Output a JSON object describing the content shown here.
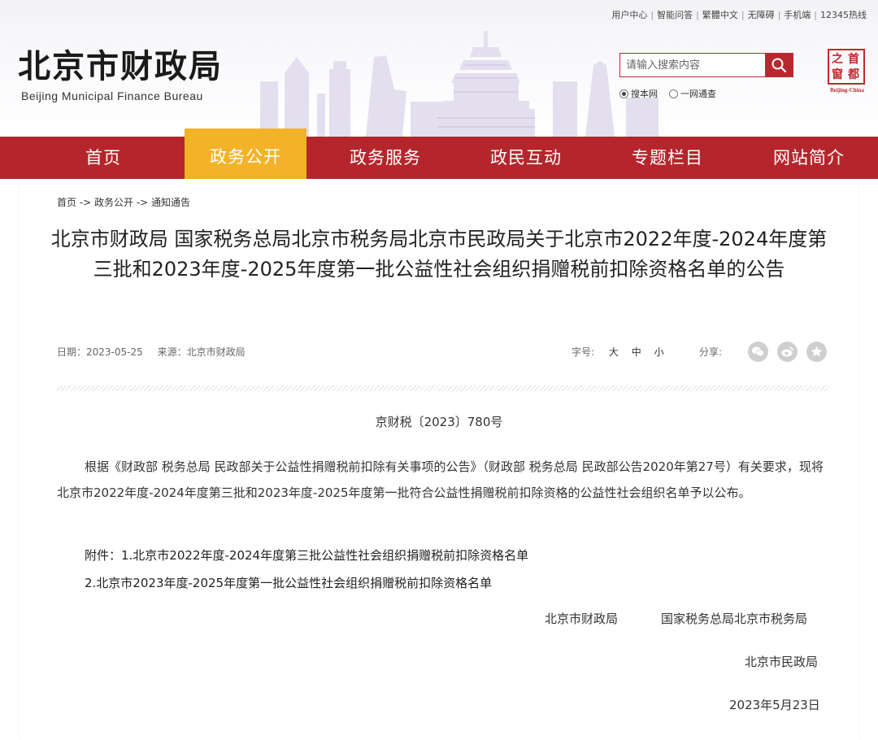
{
  "top_links": [
    "用户中心",
    "智能问答",
    "繁體中文",
    "无障碍",
    "手机端",
    "12345热线"
  ],
  "logo": {
    "cn": "北京市财政局",
    "en": "Beijing Municipal Finance Bureau"
  },
  "search": {
    "placeholder": "请输入搜索内容",
    "icon": "search-icon"
  },
  "search_scope": {
    "options": [
      "搜本网",
      "一网通查"
    ],
    "selected": "搜本网"
  },
  "capital_logo": {
    "chars": [
      "之",
      "首",
      "窗",
      "都"
    ],
    "en": "Beijing-China"
  },
  "nav": {
    "items": [
      "首页",
      "政务公开",
      "政务服务",
      "政民互动",
      "专题栏目",
      "网站简介"
    ],
    "active": "政务公开"
  },
  "breadcrumb": "首页 -> 政务公开 -> 通知通告",
  "article": {
    "title": "北京市财政局 国家税务总局北京市税务局北京市民政局关于北京市2022年度-2024年度第三批和2023年度-2025年度第一批公益性社会组织捐赠税前扣除资格名单的公告",
    "date": "日期：2023-05-25",
    "source": "来源：北京市财政局",
    "font_label": "字号:",
    "font_sizes": [
      "大",
      "中",
      "小"
    ],
    "share_label": "分享:",
    "share_icons": [
      "wechat-icon",
      "weibo-icon",
      "star-icon"
    ],
    "doc_no": "京财税〔2023〕780号",
    "body": "根据《财政部 税务总局 民政部关于公益性捐赠税前扣除有关事项的公告》（财政部 税务总局 民政部公告2020年第27号）有关要求，现将北京市2022年度-2024年度第三批和2023年度-2025年度第一批符合公益性捐赠税前扣除资格的公益性社会组织名单予以公布。",
    "attachment1": "附件：1.北京市2022年度-2024年度第三批公益性社会组织捐赠税前扣除资格名单",
    "attachment2": "2.北京市2023年度-2025年度第一批公益性社会组织捐赠税前扣除资格名单",
    "signatories": [
      "北京市财政局",
      "国家税务总局北京市税务局",
      "北京市民政局"
    ],
    "sign_date": "2023年5月23日"
  },
  "colors": {
    "brand_red": "#b5262c",
    "nav_active": "#f3b328"
  }
}
